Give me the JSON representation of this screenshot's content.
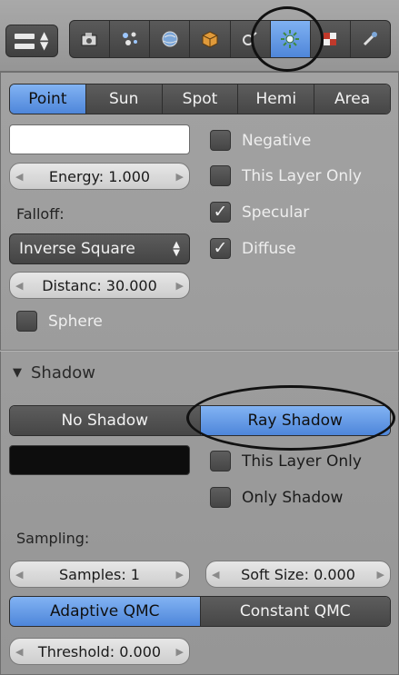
{
  "header": {
    "tabs": [
      {
        "icon": "camera-icon",
        "active": false
      },
      {
        "icon": "particles-icon",
        "active": false
      },
      {
        "icon": "world-icon",
        "active": false
      },
      {
        "icon": "object-cube-icon",
        "active": false
      },
      {
        "icon": "constraints-icon",
        "active": false
      },
      {
        "icon": "lamp-icon",
        "active": true
      },
      {
        "icon": "texture-icon",
        "active": false
      },
      {
        "icon": "modifier-icon",
        "active": false
      }
    ]
  },
  "lamp": {
    "types": [
      "Point",
      "Sun",
      "Spot",
      "Hemi",
      "Area"
    ],
    "selected_type": "Point",
    "color": "#ffffff",
    "energy": "Energy: 1.000",
    "falloff_label": "Falloff:",
    "falloff_value": "Inverse Square",
    "distance": "Distanc: 30.000",
    "sphere_label": "Sphere",
    "checks": {
      "negative": "Negative",
      "this_layer_only": "This Layer Only",
      "specular": "Specular",
      "diffuse": "Diffuse"
    },
    "check_states": {
      "negative": false,
      "this_layer_only": false,
      "specular": true,
      "diffuse": true,
      "sphere": false
    }
  },
  "shadow": {
    "title": "Shadow",
    "modes": [
      "No Shadow",
      "Ray Shadow"
    ],
    "selected_mode": "Ray Shadow",
    "color": "#0d0d0d",
    "this_layer_only": "This Layer Only",
    "only_shadow": "Only Shadow",
    "sampling_label": "Sampling:",
    "samples": "Samples: 1",
    "soft_size": "Soft Size: 0.000",
    "qmc_modes": [
      "Adaptive QMC",
      "Constant QMC"
    ],
    "selected_qmc": "Adaptive QMC",
    "threshold": "Threshold: 0.000"
  }
}
